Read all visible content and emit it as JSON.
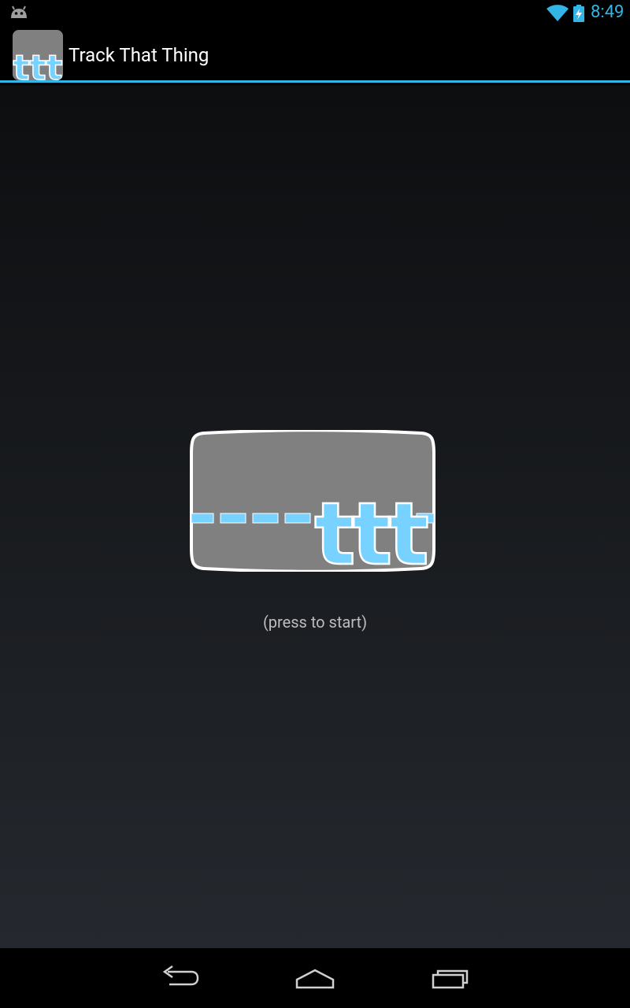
{
  "status_bar": {
    "time": "8:49",
    "icons": [
      "android-icon",
      "wifi-icon",
      "battery-charging-icon"
    ],
    "accent_color": "#33b5e5"
  },
  "action_bar": {
    "title": "Track That Thing",
    "icon_text": "ttt",
    "divider_color": "#33b5e5"
  },
  "main": {
    "logo_text": "ttt",
    "hint": "(press to start)",
    "logo_colors": {
      "background": "#808080",
      "border": "#ffffff",
      "accent": "#78d2ff"
    }
  },
  "nav_bar": {
    "buttons": [
      "back-icon",
      "home-icon",
      "recents-icon"
    ]
  }
}
